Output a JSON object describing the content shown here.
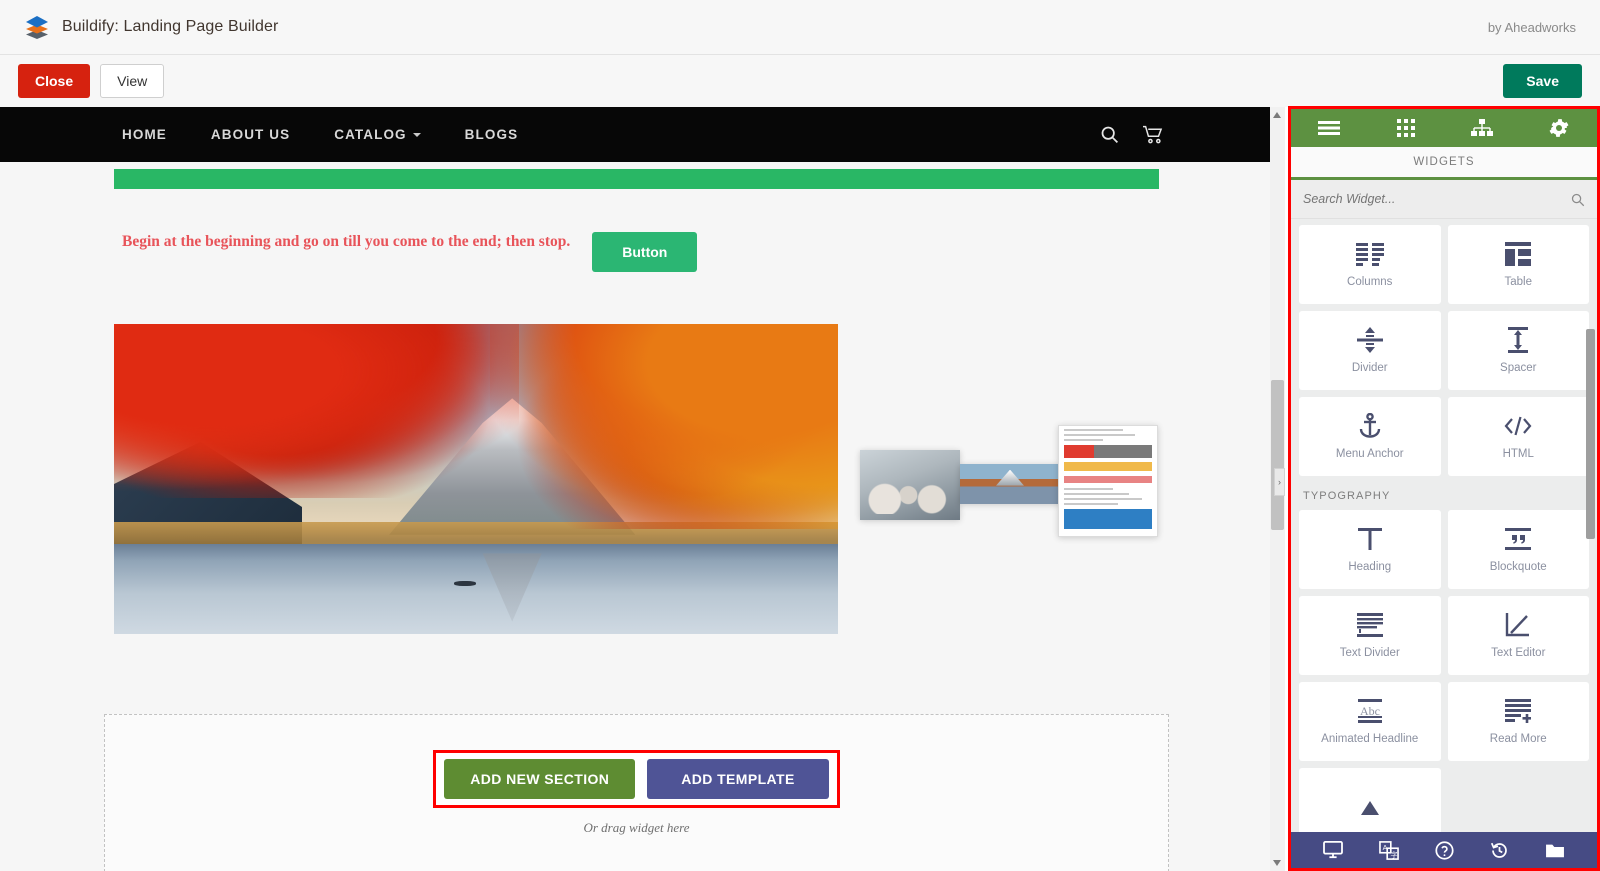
{
  "app": {
    "title": "Buildify: Landing Page Builder",
    "vendor": "by Aheadworks",
    "logo_icon": "layers-icon"
  },
  "actions": {
    "close_label": "Close",
    "view_label": "View",
    "save_label": "Save"
  },
  "canvas": {
    "site_nav": {
      "items": [
        {
          "label": "HOME",
          "has_caret": false
        },
        {
          "label": "ABOUT US",
          "has_caret": false
        },
        {
          "label": "CATALOG",
          "has_caret": true
        },
        {
          "label": "BLOGS",
          "has_caret": false
        }
      ],
      "icons": [
        {
          "name": "search-icon"
        },
        {
          "name": "cart-icon"
        }
      ]
    },
    "quote_text": "Begin at the beginning and go on till you come to the end; then stop.",
    "button_label": "Button",
    "hero_image_alt": "Mount Fuji with autumn maple leaves reflected in lake",
    "drag_ghosts": [
      {
        "name": "ghost-people-photo"
      },
      {
        "name": "ghost-fuji-photo"
      },
      {
        "name": "ghost-report-document"
      }
    ],
    "dropzone": {
      "add_section_label": "ADD NEW SECTION",
      "add_template_label": "ADD TEMPLATE",
      "drag_hint": "Or drag widget here"
    }
  },
  "panel": {
    "tabs": [
      {
        "name": "menu-tab",
        "icon": "hamburger-icon",
        "active": true
      },
      {
        "name": "widgets-tab",
        "icon": "grid-icon",
        "active": false
      },
      {
        "name": "structure-tab",
        "icon": "sitemap-icon",
        "active": false
      },
      {
        "name": "settings-tab",
        "icon": "gear-icon",
        "active": false
      }
    ],
    "title": "WIDGETS",
    "search": {
      "placeholder": "Search Widget...",
      "value": "",
      "icon": "search-icon"
    },
    "groups": [
      {
        "heading": "",
        "widgets": [
          {
            "label": "Columns",
            "icon": "columns-icon"
          },
          {
            "label": "Table",
            "icon": "table-icon"
          },
          {
            "label": "Divider",
            "icon": "divider-icon"
          },
          {
            "label": "Spacer",
            "icon": "spacer-icon"
          },
          {
            "label": "Menu Anchor",
            "icon": "anchor-icon"
          },
          {
            "label": "HTML",
            "icon": "code-icon"
          }
        ]
      },
      {
        "heading": "TYPOGRAPHY",
        "widgets": [
          {
            "label": "Heading",
            "icon": "heading-icon"
          },
          {
            "label": "Blockquote",
            "icon": "quote-icon"
          },
          {
            "label": "Text Divider",
            "icon": "text-divider-icon"
          },
          {
            "label": "Text Editor",
            "icon": "text-editor-icon"
          },
          {
            "label": "Animated Headline",
            "icon": "animated-headline-icon"
          },
          {
            "label": "Read More",
            "icon": "read-more-icon"
          }
        ]
      }
    ],
    "bottom_icons": [
      {
        "name": "responsive-mode-icon"
      },
      {
        "name": "translate-icon"
      },
      {
        "name": "help-icon"
      },
      {
        "name": "history-icon"
      },
      {
        "name": "folder-icon"
      }
    ]
  },
  "colors": {
    "panel_accent": "#5d9141",
    "highlight_border": "#ff0000",
    "close_button": "#d6220f",
    "save_button": "#007a5c",
    "site_green": "#29b765",
    "quote_red": "#e8545a",
    "add_section_green": "#5e8c32",
    "add_template_purple": "#4f5496",
    "panel_bottom": "#464b84"
  }
}
